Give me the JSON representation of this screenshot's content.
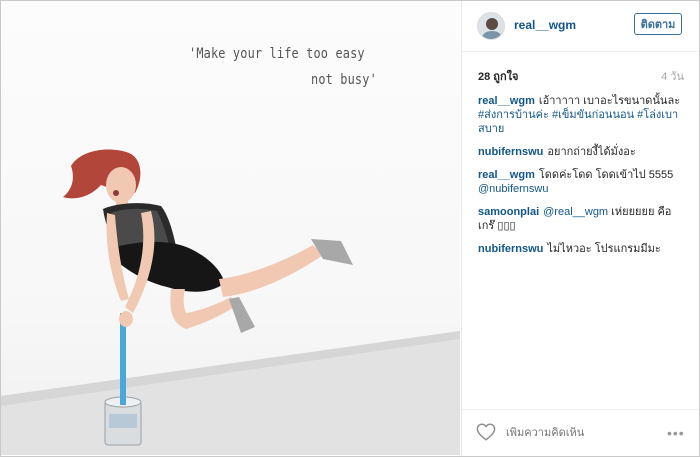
{
  "photo": {
    "quote_line1": "'Make your life too easy",
    "quote_line2": "not busy'"
  },
  "header": {
    "username": "real__wgm",
    "follow_label": "ติดตาม"
  },
  "meta": {
    "likes": "28 ถูกใจ",
    "time": "4 วัน"
  },
  "comments": [
    {
      "user": "real__wgm",
      "text": "เอ้าาาาา เบาอะไรขนาดนั้นละ ",
      "hash1": "#ส่งการบ้านค่ะ",
      "hash2": "#เข็มขันก่อนนอน",
      "hash3": "#โล่งเบาสบาย"
    },
    {
      "user": "nubifernswu",
      "text": "อยากถ่ายงี้ได้มั่งอะ"
    },
    {
      "user": "real__wgm",
      "text": "โดดค่ะโดด โดดเข้าไป 5555 ",
      "mention": "@nubifernswu"
    },
    {
      "user": "samoonplai",
      "mention": "@real__wgm",
      "text": " เห่ยยยยย คือ เกร๊ ▯▯▯"
    },
    {
      "user": "nubifernswu",
      "text": "ไม่ไหวอะ โปรแกรมมีมะ"
    }
  ],
  "footer": {
    "comment_placeholder": "เพิ่มความคิดเห็น",
    "more_label": "•••"
  },
  "icons": {
    "like": "heart-icon",
    "more": "more-options-icon"
  },
  "colors": {
    "link_blue": "#125688",
    "follow_blue": "#3f729b",
    "muted": "#a5a7aa"
  }
}
